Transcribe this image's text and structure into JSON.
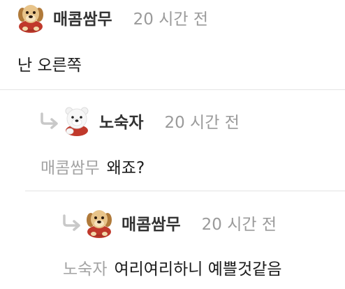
{
  "comments": [
    {
      "author": "매콤쌈무",
      "time": "20 시간 전",
      "avatar_icon": "puppy-avatar-icon",
      "mention": "",
      "text": "난 오른쪽"
    },
    {
      "author": "노숙자",
      "time": "20 시간 전",
      "avatar_icon": "polar-bear-avatar-icon",
      "mention": "매콤쌈무",
      "text": "왜죠?"
    },
    {
      "author": "매콤쌈무",
      "time": "20 시간 전",
      "avatar_icon": "puppy-avatar-icon",
      "mention": "노숙자",
      "text": "여리여리하니 예쁠것같음"
    }
  ],
  "colors": {
    "author": "#333333",
    "time": "#9a9a9a",
    "mention": "#a3a3a3",
    "divider": "#e4e4e4",
    "reply_arrow": "#c8c8c8"
  }
}
